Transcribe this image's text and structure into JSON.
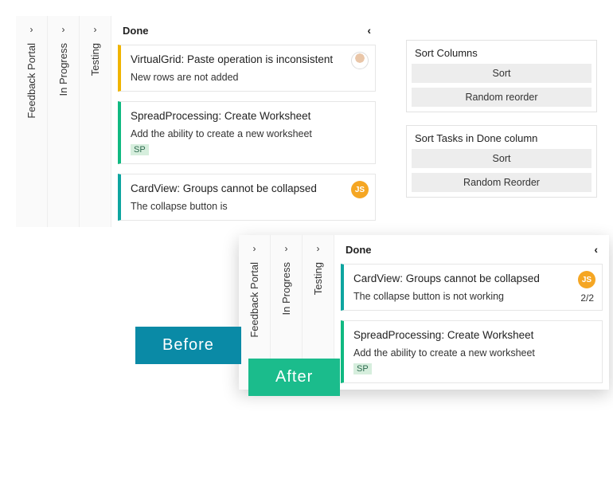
{
  "labels": {
    "before": "Before",
    "after": "After"
  },
  "collapsedColumns": [
    {
      "label": "Feedback Portal"
    },
    {
      "label": "In Progress"
    },
    {
      "label": "Testing"
    }
  ],
  "doneColumn": {
    "title": "Done"
  },
  "beforeCards": [
    {
      "color": "yellow",
      "title": "VirtualGrid: Paste operation is inconsistent",
      "desc": "New rows are not added",
      "avatarType": "person"
    },
    {
      "color": "green",
      "title": "SpreadProcessing: Create Worksheet",
      "desc": "Add the ability to create a new worksheet",
      "badgeSP": "SP"
    },
    {
      "color": "teal",
      "title": "CardView: Groups cannot be collapsed",
      "desc": "The collapse button is",
      "avatarType": "orange",
      "avatarText": "JS"
    }
  ],
  "afterCards": [
    {
      "color": "teal",
      "title": "CardView: Groups cannot be collapsed",
      "desc": "The collapse button is not working",
      "avatarType": "orange",
      "avatarText": "JS",
      "count": "2/2"
    },
    {
      "color": "green",
      "title": "SpreadProcessing: Create Worksheet",
      "desc": "Add the ability to create a new worksheet",
      "badgeSP": "SP"
    }
  ],
  "panels": {
    "sortColumns": {
      "title": "Sort Columns",
      "sort": "Sort",
      "random": "Random reorder"
    },
    "sortTasks": {
      "title": "Sort Tasks in Done column",
      "sort": "Sort",
      "random": "Random Reorder"
    }
  }
}
